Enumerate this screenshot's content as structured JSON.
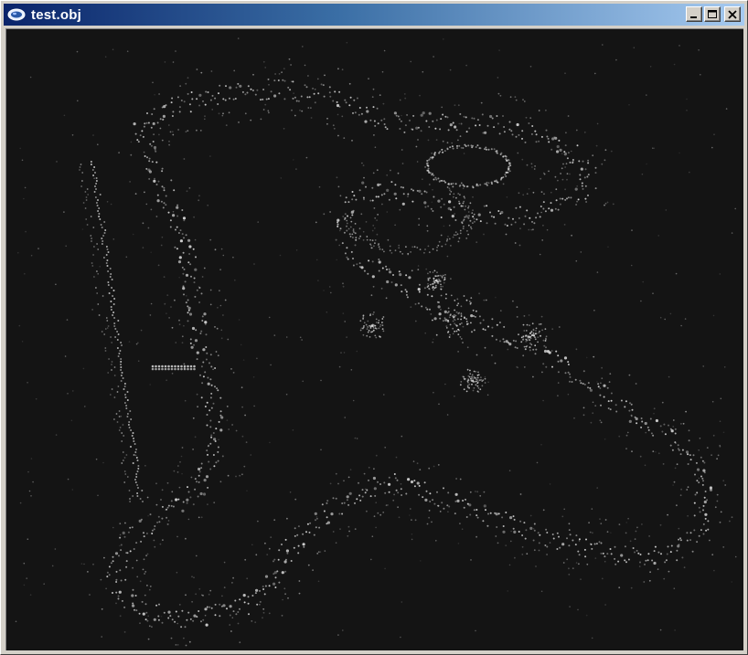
{
  "window": {
    "title": "test.obj",
    "title_icon": "model-viewer-icon",
    "controls": {
      "minimize_icon": "minimize-icon",
      "maximize_icon": "maximize-icon",
      "close_icon": "close-icon"
    }
  },
  "colors": {
    "titlebar_start": "#0a246a",
    "titlebar_end": "#a6caf0",
    "canvas_background": "#141414",
    "point_color": "#d8d8d8"
  }
}
